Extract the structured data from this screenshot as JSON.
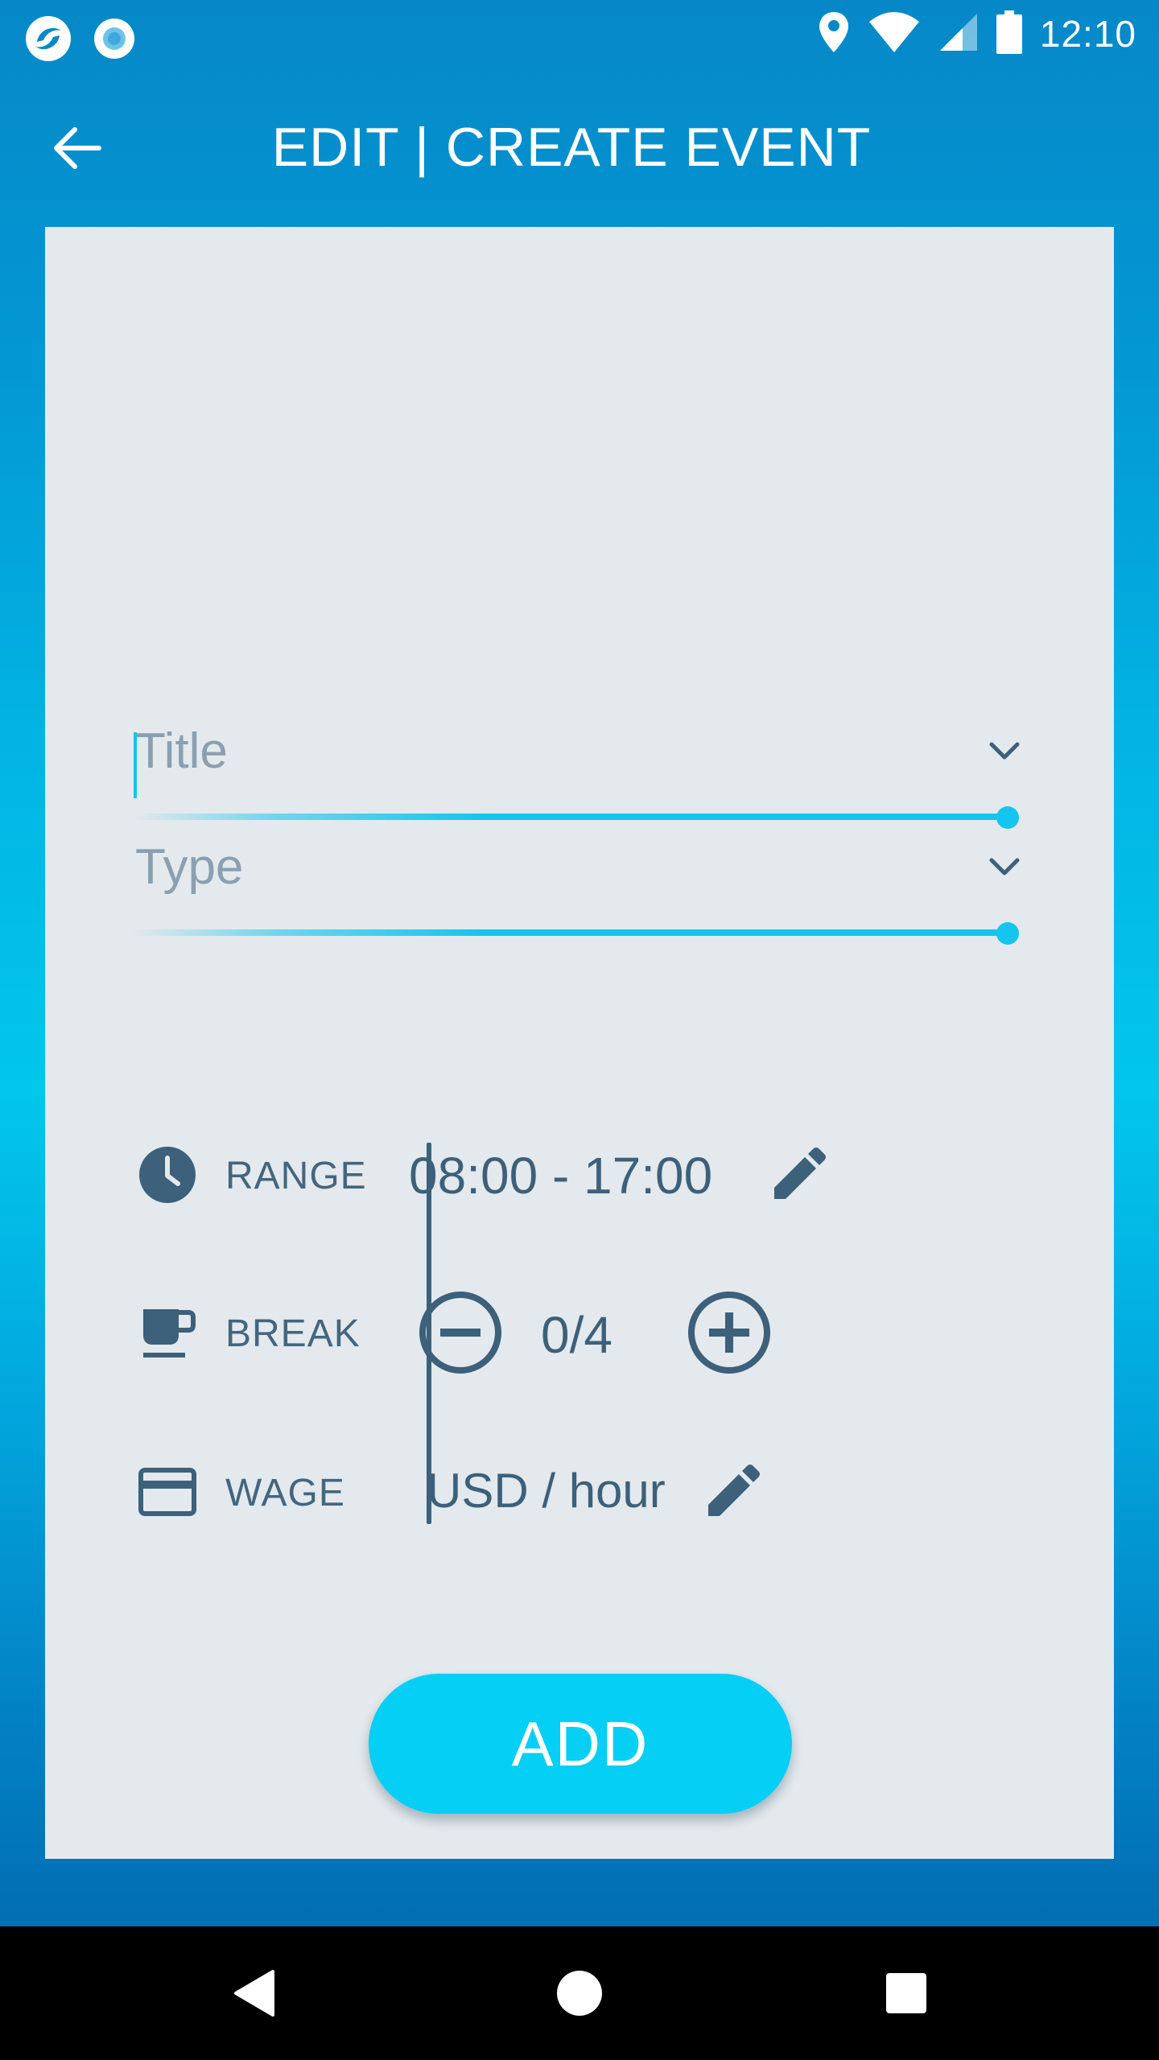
{
  "status_bar": {
    "time": "12:10",
    "left_icons": [
      "app-logo-icon",
      "record-icon"
    ],
    "right_icons": [
      "location-icon",
      "wifi-icon",
      "signal-icon",
      "battery-icon"
    ]
  },
  "app_bar": {
    "title": "EDIT | CREATE EVENT",
    "back_icon": "arrow-back-icon"
  },
  "form": {
    "title_field": {
      "placeholder": "Title",
      "value": ""
    },
    "type_field": {
      "placeholder": "Type",
      "value": ""
    },
    "range": {
      "label": "RANGE",
      "value": "08:00 - 17:00",
      "icon": "clock-icon"
    },
    "break": {
      "label": "BREAK",
      "value": "0/4",
      "icon": "coffee-cup-icon"
    },
    "wage": {
      "label": "WAGE",
      "value": "USD / hour",
      "icon": "credit-card-icon"
    },
    "add_label": "ADD"
  },
  "colors": {
    "accent": "#13c5ef",
    "button": "#05cff5",
    "text": "#3d607b",
    "card": "#e3e9ec"
  },
  "nav_bar": {
    "buttons": [
      "back-triangle-icon",
      "home-circle-icon",
      "recents-square-icon"
    ]
  }
}
